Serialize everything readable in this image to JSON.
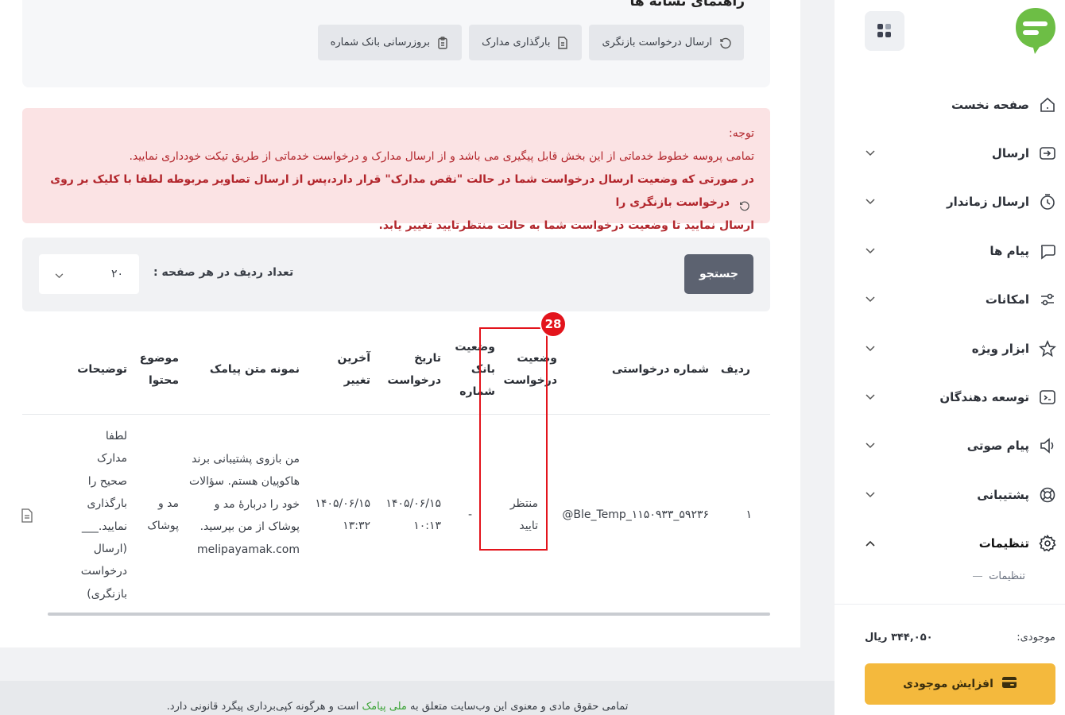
{
  "colors": {
    "brand_green": "#6dbe45",
    "danger": "#e3141c",
    "notice_bg": "#fbe3e4",
    "notice_text": "#b2262c",
    "charge_button": "#f4b93d",
    "search_button": "#5c6270"
  },
  "sidebar": {
    "items": [
      {
        "label": "صفحه نخست",
        "icon": "home-icon"
      },
      {
        "label": "ارسال",
        "icon": "send-icon"
      },
      {
        "label": "ارسال زماندار",
        "icon": "timer-icon"
      },
      {
        "label": "پیام ها",
        "icon": "messages-icon"
      },
      {
        "label": "امکانات",
        "icon": "sliders-icon"
      },
      {
        "label": "ابزار ویژه",
        "icon": "star-icon"
      },
      {
        "label": "توسعه دهندگان",
        "icon": "code-icon"
      },
      {
        "label": "پیام صوتی",
        "icon": "speaker-icon"
      },
      {
        "label": "پشتیبانی",
        "icon": "lifebuoy-icon"
      },
      {
        "label": "تنظیمات",
        "icon": "gear-icon"
      }
    ],
    "sub_item": "تنظیمات",
    "balance_label": "موجودی:",
    "balance_value": "۳۴۴,۰۵۰ ریال",
    "charge_button": "افزایش موجودی"
  },
  "guide": {
    "title": "راهنمای نشانه ها",
    "buttons": [
      {
        "label": "ارسال درخواست بازنگری",
        "icon": "refresh-icon"
      },
      {
        "label": "بارگذاری مدارک",
        "icon": "document-icon"
      },
      {
        "label": "بروزرسانی بانک شماره",
        "icon": "clipboard-icon"
      }
    ]
  },
  "notice": {
    "heading": "توجه:",
    "line1": "تمامی پروسه خطوط خدماتی از این بخش قابل پیگیری می باشد و از ارسال مدارک و درخواست خدماتی از طریق تیکت خودداری نمایید.",
    "line2_a": "در صورتی که وضعیت ارسال درخواست شما در حالت \"نقص مدارک\" قرار دارد،پس از ارسال تصاویر مربوطه لطفا با کلیک بر روی",
    "line2_b": "درخواست بازنگری را",
    "line3": "ارسال نمایید تا وضعیت درخواست شما به حالت منتظرتایید تغییر یابد."
  },
  "filter": {
    "search_button": "جستجو",
    "rows_label": "تعداد ردیف در هر صفحه :",
    "rows_value": "۲۰"
  },
  "table": {
    "headers": {
      "row": "ردیف",
      "request_number": "شماره درخواستی",
      "request_status": "وضعیت درخواست",
      "bank_status": "وضعیت بانک شماره",
      "request_date": "تاریخ درخواست",
      "last_change": "آخرین تغییر",
      "sample_text": "نمونه متن پیامک",
      "content_topic": "موضوع محتوا",
      "description": "توضیحات"
    },
    "rows": [
      {
        "row": "۱",
        "request_number": "@Ble_Temp_۱۱۵۰۹۳۳_۵۹۲۳۶",
        "request_status": "منتظر تایید",
        "bank_status": "-",
        "request_date": "۱۴۰۵/۰۶/۱۵ ۱۰:۱۳",
        "last_change": "۱۴۰۵/۰۶/۱۵ ۱۳:۳۲",
        "sample_text": "من بازوی پشتیبانی برند هاکوپیان هستم. سؤالات خود را دربارهٔ مد و پوشاک از من بپرسید. melipayamak.com",
        "content_topic": "مد و پوشاک",
        "description": "لطفا مدارک صحیح را بارگذاری نمایید.___ (ارسال درخواست بازنگری)"
      }
    ]
  },
  "annotation_badge": "28",
  "footer": {
    "text_before": "تمامی حقوق مادی و معنوی این وب‌سایت متعلق به",
    "brand": "ملی پیامک",
    "text_after": "است و هرگونه کپی‌برداری پیگرد قانونی دارد."
  }
}
